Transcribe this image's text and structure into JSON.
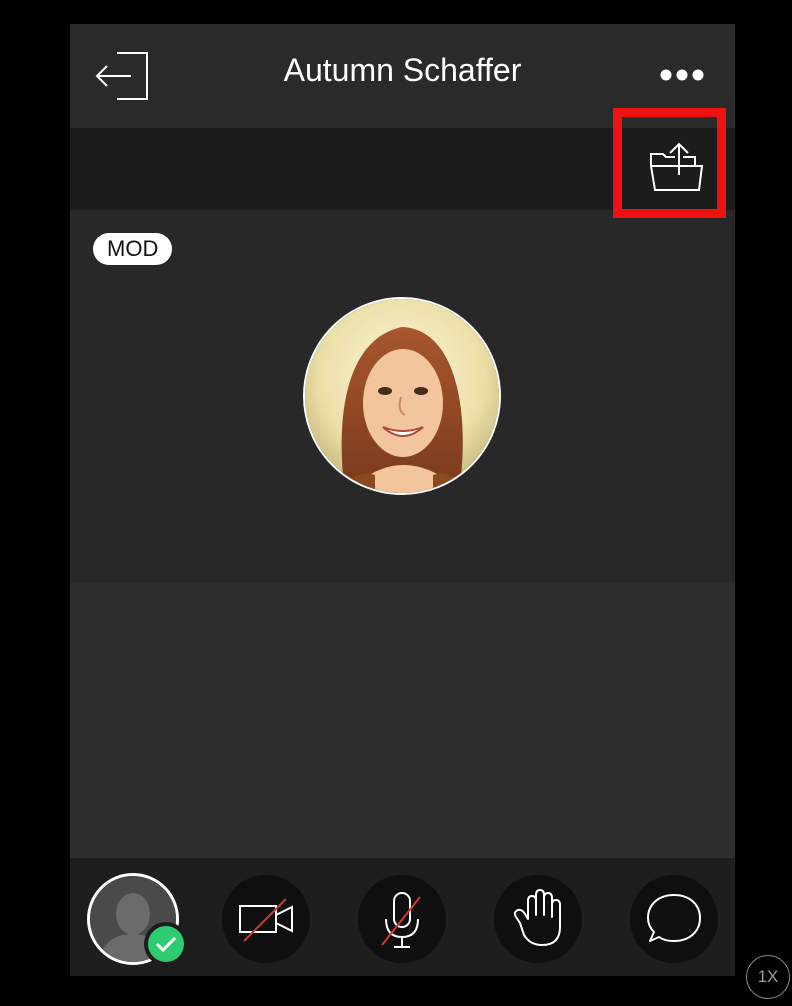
{
  "header": {
    "title": "Autumn Schaffer",
    "exit_icon": "exit-door-icon",
    "more_icon": "more-dots-icon"
  },
  "toolbar": {
    "share_icon": "share-folder-icon",
    "highlight_color": "#ee1111"
  },
  "stage": {
    "badge": "MOD",
    "avatar": "participant-photo"
  },
  "controls": {
    "items": [
      {
        "name": "self-avatar",
        "icon": "user-silhouette-icon",
        "status_icon": "check-icon",
        "status_color": "#2ecc71"
      },
      {
        "name": "video-off",
        "icon": "video-camera-off-icon",
        "accent": "#d9342b"
      },
      {
        "name": "mic-off",
        "icon": "microphone-off-icon",
        "accent": "#d9342b"
      },
      {
        "name": "raise-hand",
        "icon": "hand-icon"
      },
      {
        "name": "chat",
        "icon": "chat-bubble-icon"
      }
    ]
  },
  "playback": {
    "speed": "1X"
  }
}
